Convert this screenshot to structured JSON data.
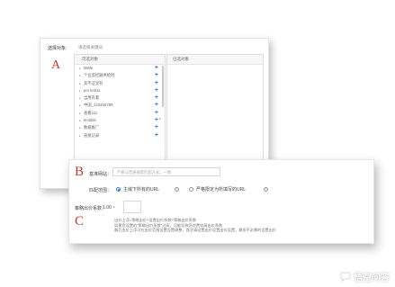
{
  "top_panel": {
    "label": "选择对象:",
    "hint": "请选择关键词",
    "marker": "A",
    "available_header": "可选对象",
    "selected_header": "已选对象",
    "items": [
      {
        "label": "5Mile"
      },
      {
        "label": "个业监控器供给时"
      },
      {
        "label": "其不这里有"
      },
      {
        "label": "pm test11"
      },
      {
        "label": "当用有着"
      },
      {
        "label": "中国_123456789"
      },
      {
        "label": "查看111"
      },
      {
        "label": "B-ddds"
      },
      {
        "label": "数据推广"
      },
      {
        "label": "直接记录"
      }
    ]
  },
  "settings_card": {
    "marker_b": "B",
    "marker_c": "C",
    "site_label": "基准网站：",
    "site_placeholder": "严格与普通搜索匹配方式，一致",
    "match_label": "匹配范围：",
    "match_options": [
      {
        "label": "主域下所有的URL",
        "selected": true
      },
      {
        "label": "严格限定为所填写的URL",
        "selected": false
      }
    ],
    "factor_label": "策略出价系数：",
    "factor_value": "1.00 ~",
    "notes": [
      "出价上浮=策略出价×设置出价系数×策略出价系数",
      "如果您设置的\"策略出价系数\"过高，可能导致您花费较高出价系数",
      "最后出价上浮可在出价范围设置设置调整，首次请设置出价设置出价设置，最多不必需的设置出价"
    ]
  },
  "watermark": {
    "text": "悟空问答",
    "icon": "chat-bubble-icon"
  }
}
